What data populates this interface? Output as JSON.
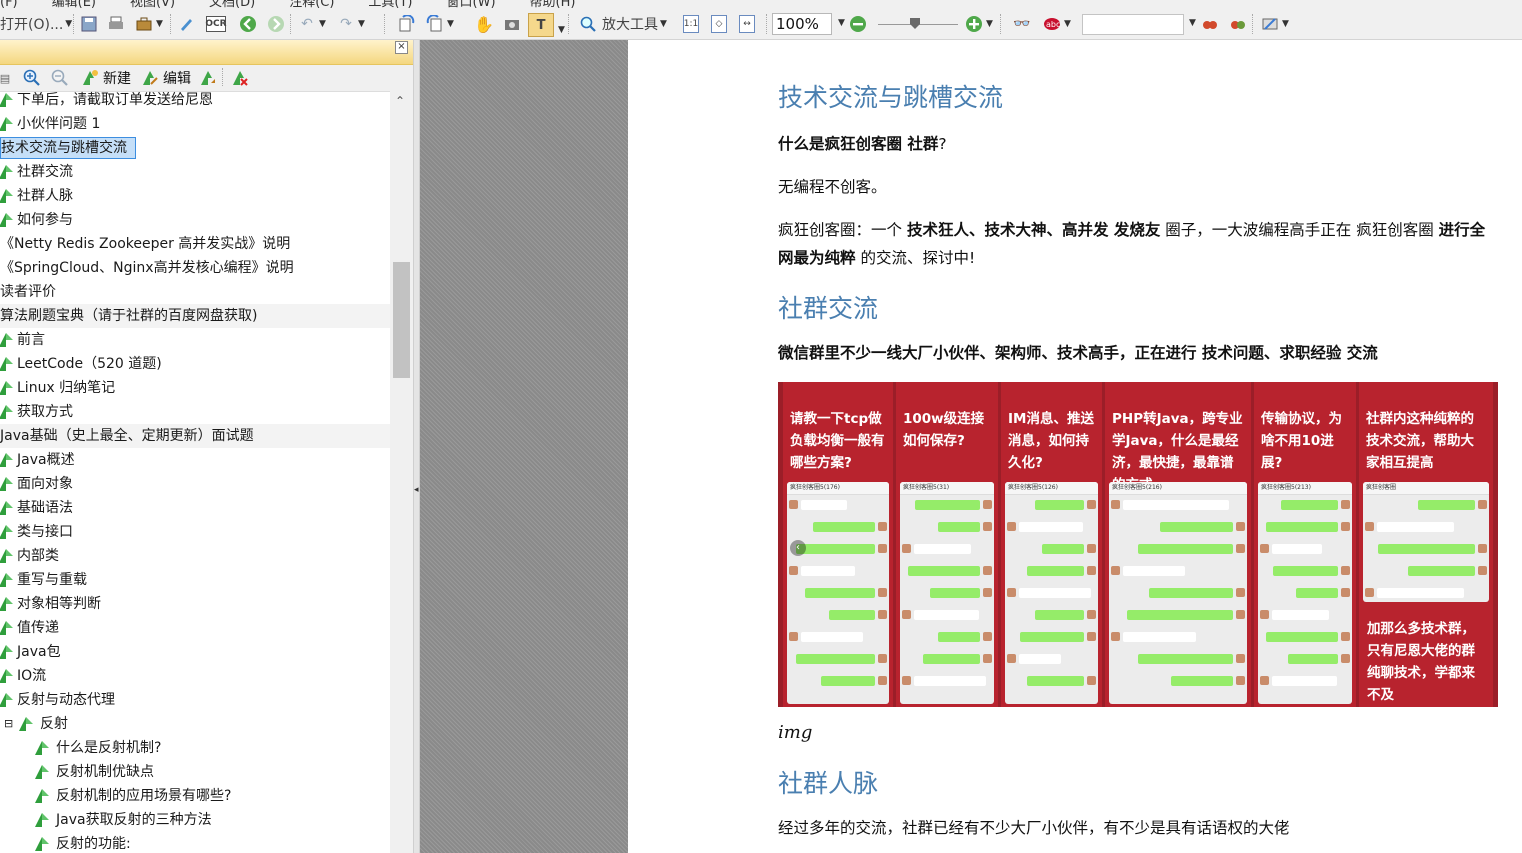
{
  "toolbar": {
    "menu_remnant": [
      "(F)",
      "编辑(E)",
      "视图(V)",
      "文档(D)",
      "注释(C)",
      "工具(T)",
      "窗口(W)",
      "帮助(H)"
    ],
    "open_label": "打开(O)...",
    "zoom_tool_label": "放大工具",
    "zoom_value": "100%",
    "find_value": ""
  },
  "bookmarks_toolbar": {
    "new_label": "新建",
    "edit_label": "编辑"
  },
  "tree": [
    {
      "label": "下单后，请截取订单发送给尼恩",
      "indent": 1,
      "icon": true
    },
    {
      "label": "小伙伴问题 1",
      "indent": 1,
      "icon": true
    },
    {
      "label": "技术交流与跳槽交流",
      "indent": 0,
      "icon": false,
      "selected": true
    },
    {
      "label": "社群交流",
      "indent": 1,
      "icon": true
    },
    {
      "label": "社群人脉",
      "indent": 1,
      "icon": true
    },
    {
      "label": "如何参与",
      "indent": 1,
      "icon": true
    },
    {
      "label": "《Netty Redis Zookeeper 高并发实战》说明",
      "indent": 0,
      "icon": false
    },
    {
      "label": "《SpringCloud、Nginx高并发核心编程》说明",
      "indent": 0,
      "icon": false
    },
    {
      "label": "读者评价",
      "indent": 0,
      "icon": false
    },
    {
      "label": "算法刷题宝典（请于社群的百度网盘获取)",
      "indent": 0,
      "icon": false,
      "shade": true
    },
    {
      "label": "前言",
      "indent": 1,
      "icon": true
    },
    {
      "label": "LeetCode（520 道题)",
      "indent": 1,
      "icon": true
    },
    {
      "label": "Linux 归纳笔记",
      "indent": 1,
      "icon": true
    },
    {
      "label": "获取方式",
      "indent": 1,
      "icon": true
    },
    {
      "label": "Java基础（史上最全、定期更新）面试题",
      "indent": 0,
      "icon": false,
      "shade": true
    },
    {
      "label": "Java概述",
      "indent": 1,
      "icon": true
    },
    {
      "label": "面向对象",
      "indent": 1,
      "icon": true
    },
    {
      "label": "基础语法",
      "indent": 1,
      "icon": true
    },
    {
      "label": "类与接口",
      "indent": 1,
      "icon": true
    },
    {
      "label": "内部类",
      "indent": 1,
      "icon": true
    },
    {
      "label": "重写与重载",
      "indent": 1,
      "icon": true
    },
    {
      "label": "对象相等判断",
      "indent": 1,
      "icon": true
    },
    {
      "label": "值传递",
      "indent": 1,
      "icon": true
    },
    {
      "label": "Java包",
      "indent": 1,
      "icon": true
    },
    {
      "label": "IO流",
      "indent": 1,
      "icon": true
    },
    {
      "label": "反射与动态代理",
      "indent": 1,
      "icon": true
    },
    {
      "label": "反射",
      "indent": 2,
      "icon": true,
      "expander": "⊟"
    },
    {
      "label": "什么是反射机制?",
      "indent": 3,
      "icon": true
    },
    {
      "label": "反射机制优缺点",
      "indent": 3,
      "icon": true
    },
    {
      "label": "反射机制的应用场景有哪些?",
      "indent": 3,
      "icon": true
    },
    {
      "label": "Java获取反射的三种方法",
      "indent": 3,
      "icon": true
    },
    {
      "label": "反射的功能:",
      "indent": 3,
      "icon": true
    }
  ],
  "document": {
    "h_tech": "技术交流与跳槽交流",
    "q_label_pre": "什么是",
    "q_label_bold": "疯狂创客圈 社群",
    "q_label_post": "?",
    "slogan": "无编程不创客。",
    "intro_1": "疯狂创客圈：一个 ",
    "intro_b1": "技术狂人、技术大神、高并发 发烧友",
    "intro_2": " 圈子，一大波编程高手正在 疯狂创客圈 ",
    "intro_b2": "进行全网最为纯粹",
    "intro_3": " 的交流、探讨中!",
    "h_community": "社群交流",
    "community_desc": "微信群里不少一线大厂小伙伴、架构师、技术高手，正在进行 技术问题、求职经验 交流",
    "img_caption": "img",
    "h_network": "社群人脉",
    "network_desc": "经过多年的交流，社群已经有不少大厂小伙伴，有不少是具有话语权的大佬"
  },
  "collage": {
    "questions": [
      "请教一下tcp做负载均衡一般有哪些方案?",
      "100w级连接如何保存?",
      "IM消息、推送消息，如何持久化?",
      "PHP转Java，跨专业学Java，什么是最经济，最快捷，最靠谱的方式",
      "传输协议，为啥不用10进展?",
      "社群内这种纯粹的技术交流，帮助大家相互提高"
    ],
    "bottom_right": "加那么多技术群，只有尼恩大佬的群纯聊技术，学都来不及",
    "chat_titles": [
      "疯狂创客圈5(176)",
      "疯狂创客圈5(31)",
      "疯狂创客圈5(126)",
      "疯狂创客圈5(216)",
      "疯狂创客圈5(213)",
      "疯狂创客圈"
    ],
    "colors": {
      "outer": "#9b1e28",
      "panel": "#b8232e"
    }
  },
  "colors": {
    "heading": "#4a7fb0",
    "selection_fill": "#c5dff8",
    "selection_border": "#3d8ee0",
    "panel_header": "#f4d780"
  }
}
